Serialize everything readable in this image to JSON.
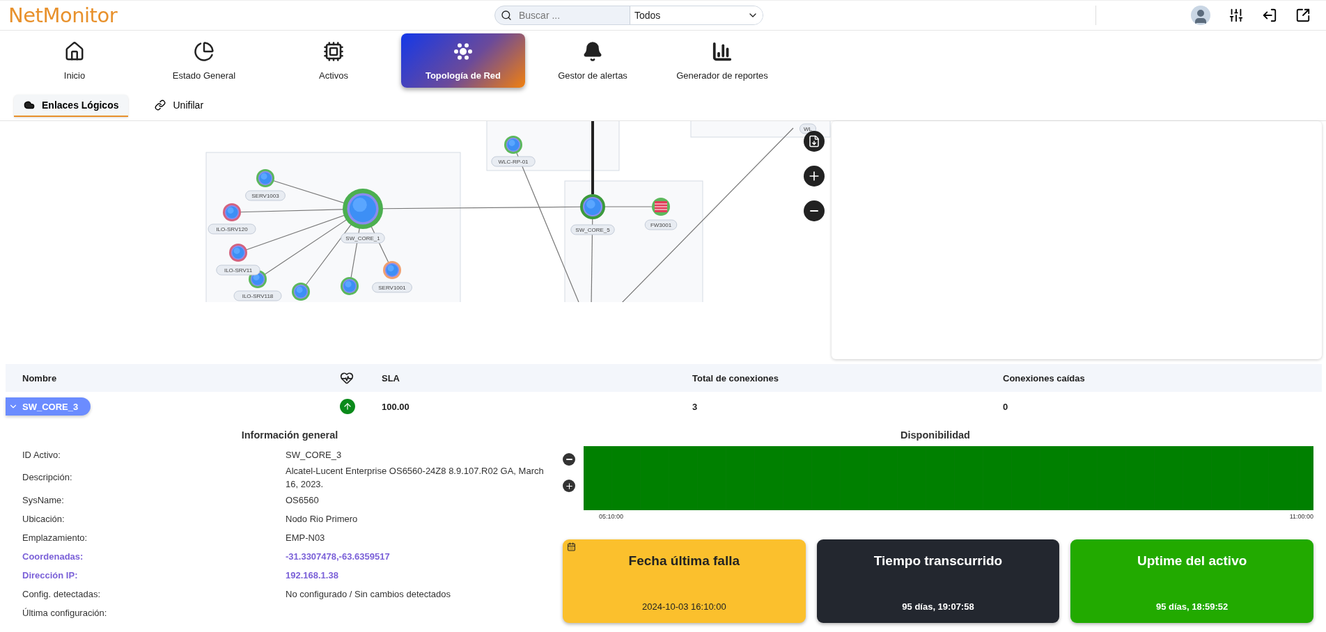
{
  "header": {
    "logo": "NetMonitor",
    "search": {
      "placeholder": "Buscar ..."
    },
    "filter": {
      "value": "Todos"
    }
  },
  "nav": [
    {
      "label": "Inicio",
      "selected": false
    },
    {
      "label": "Estado General",
      "selected": false
    },
    {
      "label": "Activos",
      "selected": false
    },
    {
      "label": "Topología de Red",
      "selected": true
    },
    {
      "label": "Gestor de alertas",
      "selected": false
    },
    {
      "label": "Generador de reportes",
      "selected": false
    }
  ],
  "subtabs": [
    {
      "label": "Enlaces Lógicos",
      "selected": true
    },
    {
      "label": "Unifilar",
      "selected": false
    }
  ],
  "topology": {
    "nodes": [
      {
        "label": "SW_CORE_1",
        "kind": "hub",
        "color": "#4caf50"
      },
      {
        "label": "SERV1003",
        "kind": "server",
        "color": "#5cb85c"
      },
      {
        "label": "ILO-SRV120",
        "kind": "server",
        "color": "#d4627e"
      },
      {
        "label": "ILO-SRV11",
        "kind": "server",
        "color": "#d4627e"
      },
      {
        "label": "ILO-SRV118",
        "kind": "server",
        "color": "#5cb85c"
      },
      {
        "kind": "server",
        "color": "#5cb85c"
      },
      {
        "kind": "server",
        "color": "#5cb85c"
      },
      {
        "label": "SERV1001",
        "kind": "server",
        "color": "#f0a070"
      },
      {
        "label": "WLC-RP-01",
        "kind": "server",
        "color": "#5cb85c"
      },
      {
        "label": "SW_CORE_5",
        "kind": "switch",
        "color": "#3c9a3c"
      },
      {
        "label": "FW3001",
        "kind": "firewall",
        "color": "#5cb85c"
      },
      {
        "label": "WL",
        "kind": "tag"
      }
    ]
  },
  "table": {
    "columns": [
      "Nombre",
      "SLA",
      "Total de conexiones",
      "Conexiones caídas"
    ],
    "rows": [
      {
        "name": "SW_CORE_3",
        "expanded": true,
        "online": true,
        "sla": "100.00",
        "total": "3",
        "down": "0"
      }
    ]
  },
  "info": {
    "title": "Información general",
    "rows": [
      {
        "label": "ID Activo:",
        "value": "SW_CORE_3",
        "kind": "plain"
      },
      {
        "label": "Descripción:",
        "value": "Alcatel-Lucent Enterprise OS6560-24Z8 8.9.107.R02 GA, March 16, 2023.",
        "kind": "plain"
      },
      {
        "label": "SysName:",
        "value": "OS6560",
        "kind": "plain"
      },
      {
        "label": "Ubicación:",
        "value": "Nodo Rio Primero",
        "kind": "plain"
      },
      {
        "label": "Emplazamiento:",
        "value": "EMP-N03",
        "kind": "plain"
      },
      {
        "label": "Coordenadas:",
        "value": "-31.3307478,-63.6359517",
        "kind": "link"
      },
      {
        "label": "Dirección IP:",
        "value": "192.168.1.38",
        "kind": "link"
      },
      {
        "label": "Config. detectadas:",
        "value": "No configurado / Sin cambios detectados",
        "kind": "plain"
      },
      {
        "label": "Última configuración:",
        "kind": "plain"
      }
    ]
  },
  "availability": {
    "title": "Disponibilidad",
    "ticks": [
      "05:10:00",
      "11:00:00"
    ]
  },
  "cards": [
    {
      "title": "Fecha última falla",
      "value": "2024-10-03 16:10:00",
      "color": "#fbc02d",
      "dark_text": true,
      "icon": true
    },
    {
      "title": "Tiempo transcurrido",
      "value": "95 días, 19:07:58",
      "color": "#23272f",
      "dark_text": false,
      "icon": false
    },
    {
      "title": "Uptime del activo",
      "value": "95 días, 18:59:52",
      "color": "#22aa00",
      "dark_text": false,
      "icon": false
    }
  ]
}
